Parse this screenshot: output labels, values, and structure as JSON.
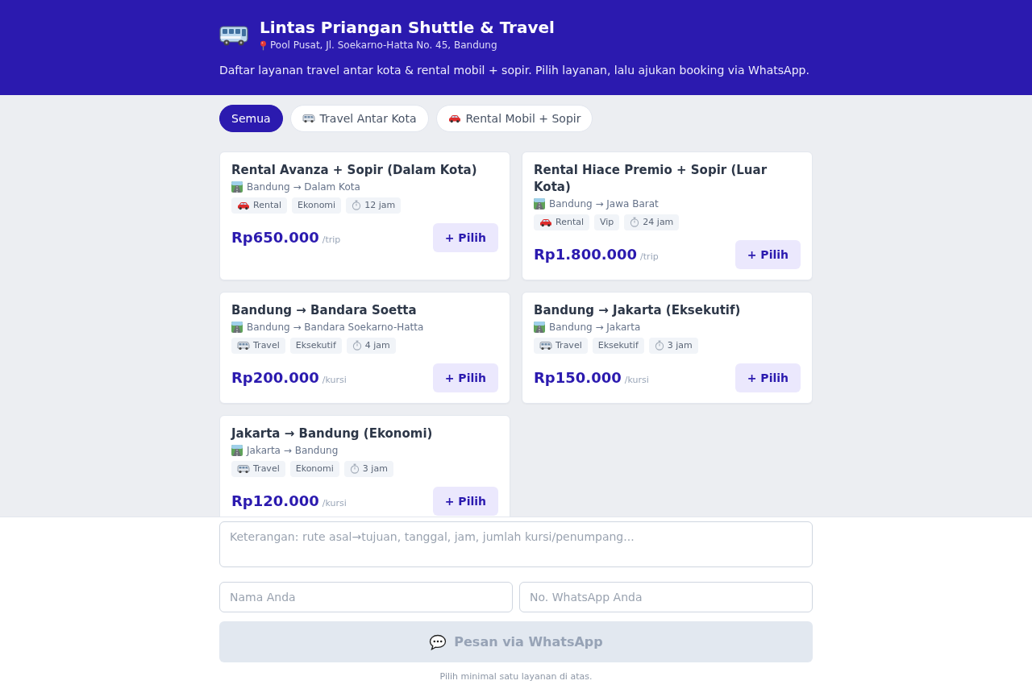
{
  "header": {
    "title": "Lintas Priangan Shuttle & Travel",
    "address": "Pool Pusat, Jl. Soekarno-Hatta No. 45, Bandung",
    "description": "Daftar layanan travel antar kota & rental mobil + sopir. Pilih layanan, lalu ajukan booking via WhatsApp."
  },
  "filters": [
    {
      "label": "Semua",
      "kind": "all",
      "selected": true
    },
    {
      "label": "Travel Antar Kota",
      "kind": "travel",
      "selected": false
    },
    {
      "label": "Rental Mobil + Sopir",
      "kind": "rental",
      "selected": false
    }
  ],
  "services": [
    {
      "kind": "rental",
      "title": "Rental Avanza + Sopir (Dalam Kota)",
      "route": "Bandung → Dalam Kota",
      "type_tag": "Rental",
      "class_tag": "Ekonomi",
      "duration": "12 jam",
      "price": "Rp650.000",
      "unit": "/trip",
      "button": "+ Pilih"
    },
    {
      "kind": "rental",
      "title": "Rental Hiace Premio + Sopir (Luar Kota)",
      "route": "Bandung → Jawa Barat",
      "type_tag": "Rental",
      "class_tag": "Vip",
      "duration": "24 jam",
      "price": "Rp1.800.000",
      "unit": "/trip",
      "button": "+ Pilih"
    },
    {
      "kind": "travel",
      "title": "Bandung → Bandara Soetta",
      "route": "Bandung → Bandara Soekarno-Hatta",
      "type_tag": "Travel",
      "class_tag": "Eksekutif",
      "duration": "4 jam",
      "price": "Rp200.000",
      "unit": "/kursi",
      "button": "+ Pilih"
    },
    {
      "kind": "travel",
      "title": "Bandung → Jakarta (Eksekutif)",
      "route": "Bandung → Jakarta",
      "type_tag": "Travel",
      "class_tag": "Eksekutif",
      "duration": "3 jam",
      "price": "Rp150.000",
      "unit": "/kursi",
      "button": "+ Pilih"
    },
    {
      "kind": "travel",
      "title": "Jakarta → Bandung (Ekonomi)",
      "route": "Jakarta → Bandung",
      "type_tag": "Travel",
      "class_tag": "Ekonomi",
      "duration": "3 jam",
      "price": "Rp120.000",
      "unit": "/kursi",
      "button": "+ Pilih"
    }
  ],
  "booking": {
    "notes": {
      "placeholder": "Keterangan: rute asal→tujuan, tanggal, jam, jumlah kursi/penumpang..."
    },
    "name": {
      "placeholder": "Nama Anda"
    },
    "phone": {
      "placeholder": "No. WhatsApp Anda"
    },
    "submit": {
      "label": "Pesan via WhatsApp",
      "disabled": true
    },
    "hint": "Pilih minimal satu layanan di atas."
  }
}
